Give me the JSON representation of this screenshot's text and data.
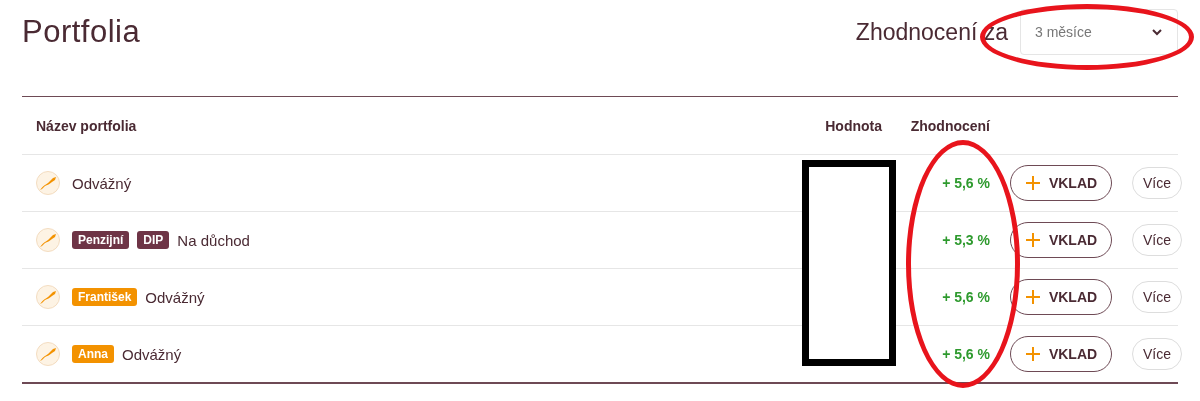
{
  "title": "Portfolia",
  "period": {
    "label": "Zhodnocení za",
    "value": "3 měsíce"
  },
  "table": {
    "columns": [
      "Název portfolia",
      "Hodnota",
      "Zhodnocení"
    ],
    "rows": [
      {
        "tags": [],
        "name": "Odvážný",
        "return": "+ 5,6 %",
        "deposit": "VKLAD",
        "more": "Více"
      },
      {
        "tags": [
          {
            "label": "Penzijní",
            "color": "#6e3446"
          },
          {
            "label": "DIP",
            "color": "#6e3446"
          }
        ],
        "name": "Na důchod",
        "return": "+ 5,3 %",
        "deposit": "VKLAD",
        "more": "Více"
      },
      {
        "tags": [
          {
            "label": "František",
            "color": "#f39200"
          }
        ],
        "name": "Odvážný",
        "return": "+ 5,6 %",
        "deposit": "VKLAD",
        "more": "Více"
      },
      {
        "tags": [
          {
            "label": "Anna",
            "color": "#f39200"
          }
        ],
        "name": "Odvážný",
        "return": "+ 5,6 %",
        "deposit": "VKLAD",
        "more": "Více"
      }
    ]
  },
  "annotations": [
    {
      "kind": "ellipse"
    },
    {
      "kind": "redaction"
    },
    {
      "kind": "ellipse"
    }
  ]
}
